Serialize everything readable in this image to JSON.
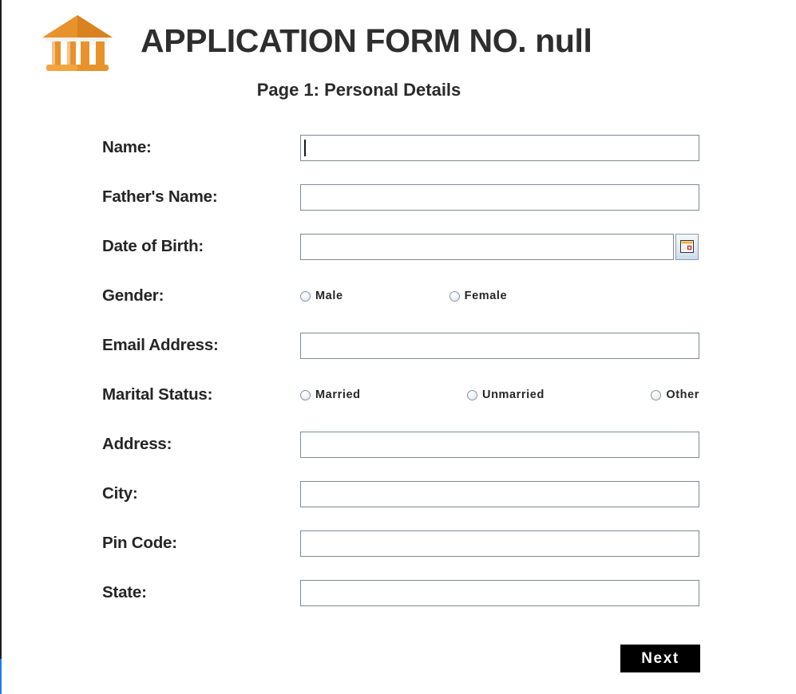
{
  "header": {
    "logo_icon": "bank-building-icon",
    "logo_color": "#e8922b",
    "title": "APPLICATION FORM NO. null"
  },
  "subtitle": "Page 1: Personal Details",
  "fields": [
    {
      "label": "Name:",
      "type": "text",
      "value": "",
      "focused": true
    },
    {
      "label": "Father's Name:",
      "type": "text",
      "value": ""
    },
    {
      "label": "Date of Birth:",
      "type": "date",
      "value": "",
      "picker_icon": "calendar-icon"
    },
    {
      "label": "Gender:",
      "type": "radio",
      "options": [
        "Male",
        "Female"
      ],
      "selected": ""
    },
    {
      "label": "Email Address:",
      "type": "text",
      "value": ""
    },
    {
      "label": "Marital Status:",
      "type": "radio",
      "options": [
        "Married",
        "Unmarried",
        "Other"
      ],
      "selected": ""
    },
    {
      "label": "Address:",
      "type": "text",
      "value": ""
    },
    {
      "label": "City:",
      "type": "text",
      "value": ""
    },
    {
      "label": "Pin Code:",
      "type": "text",
      "value": ""
    },
    {
      "label": "State:",
      "type": "text",
      "value": ""
    }
  ],
  "footer": {
    "next_label": "Next"
  },
  "colors": {
    "accent": "#e8922b",
    "input_border": "#7b8a97",
    "button_bg": "#000000",
    "button_text": "#ffffff",
    "text": "#252525"
  }
}
